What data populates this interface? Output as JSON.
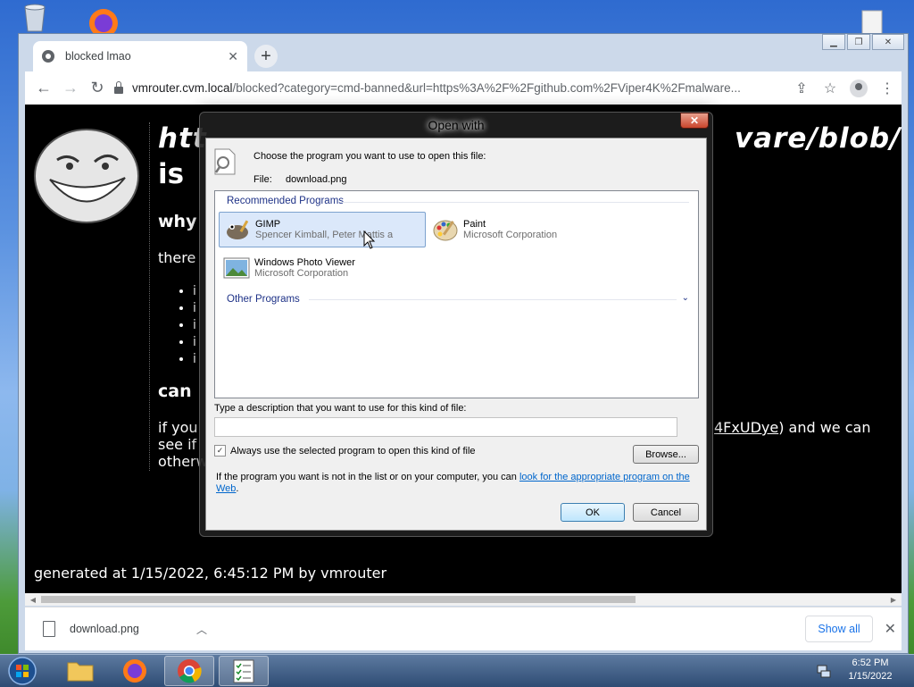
{
  "browser": {
    "tab": {
      "title": "blocked lmao"
    },
    "address": {
      "host": "vmrouter.cvm.local",
      "path": "/blocked?category=cmd-banned&url=https%3A%2F%2Fgithub.com%2FViper4K%2Fmalware..."
    }
  },
  "page": {
    "title_fragment_left": "htt",
    "title_fragment_right": "vare/blob/m",
    "is_text": "is",
    "why": "why",
    "there": "there",
    "bullet_marker": "i",
    "can": "can",
    "if_you": "if you",
    "see_if": "see if",
    "otherw": "otherw",
    "link_fragment": "4FxUDye",
    "right_text": ") and we can",
    "footer": "generated at 1/15/2022, 6:45:12 PM by vmrouter"
  },
  "downloads": {
    "file": "download.png",
    "show_all": "Show all"
  },
  "dialog": {
    "title": "Open with",
    "prompt": "Choose the program you want to use to open this file:",
    "file_label": "File:",
    "file_name": "download.png",
    "groups": {
      "recommended": "Recommended Programs",
      "other": "Other Programs"
    },
    "programs": [
      {
        "name": "GIMP",
        "publisher": "Spencer Kimball, Peter Mattis a",
        "icon": "gimp-icon",
        "selected": true
      },
      {
        "name": "Paint",
        "publisher": "Microsoft Corporation",
        "icon": "paint-icon",
        "selected": false
      },
      {
        "name": "Windows Photo Viewer",
        "publisher": "Microsoft Corporation",
        "icon": "photo-viewer-icon",
        "selected": false
      }
    ],
    "description_label": "Type a description that you want to use for this kind of file:",
    "description_value": "",
    "always_use": "Always use the selected program to open this kind of file",
    "always_use_checked": true,
    "browse": "Browse...",
    "info_text": "If the program you want is not in the list or on your computer, you can ",
    "info_link": "look for the appropriate program on the Web",
    "info_end": ".",
    "ok": "OK",
    "cancel": "Cancel"
  },
  "taskbar": {
    "time": "6:52 PM",
    "date": "1/15/2022"
  }
}
